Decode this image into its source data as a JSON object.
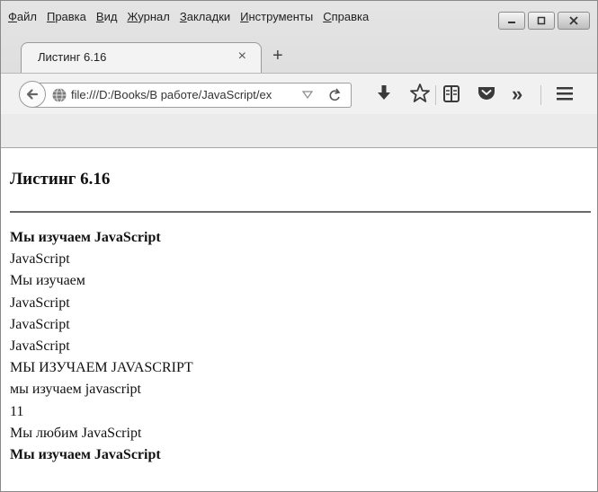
{
  "menu": [
    {
      "key": "Ф",
      "rest": "айл"
    },
    {
      "key": "П",
      "rest": "равка"
    },
    {
      "key": "В",
      "rest": "ид"
    },
    {
      "key": "Ж",
      "rest": "урнал"
    },
    {
      "key": "З",
      "rest": "акладки"
    },
    {
      "key": "И",
      "rest": "нструменты"
    },
    {
      "key": "С",
      "rest": "правка"
    }
  ],
  "tab": {
    "title": "Листинг 6.16",
    "close": "×"
  },
  "new_tab": "+",
  "address": {
    "url": "file:///D:/Books/В работе/JavaScript/ex"
  },
  "overflow_label": "»",
  "page": {
    "heading": "Листинг 6.16",
    "lines": [
      {
        "text": "Мы изучаем JavaScript",
        "bold": true
      },
      {
        "text": "JavaScript",
        "bold": false
      },
      {
        "text": "Мы изучаем",
        "bold": false
      },
      {
        "text": "JavaScript",
        "bold": false
      },
      {
        "text": "JavaScript",
        "bold": false
      },
      {
        "text": "JavaScript",
        "bold": false
      },
      {
        "text": "МЫ ИЗУЧАЕМ JAVASCRIPT",
        "bold": false
      },
      {
        "text": "мы изучаем javascript",
        "bold": false
      },
      {
        "text": "11",
        "bold": false
      },
      {
        "text": "Мы любим JavaScript",
        "bold": false
      },
      {
        "text": "Мы изучаем JavaScript",
        "bold": true
      }
    ]
  },
  "icons": [
    "back-arrow-icon",
    "globe-icon",
    "dropdown-arrow-icon",
    "reload-icon",
    "download-icon",
    "bookmark-star-icon",
    "reading-list-icon",
    "pocket-icon",
    "overflow-chevron-icon",
    "hamburger-menu-icon",
    "minimize-icon",
    "maximize-icon",
    "close-icon"
  ]
}
